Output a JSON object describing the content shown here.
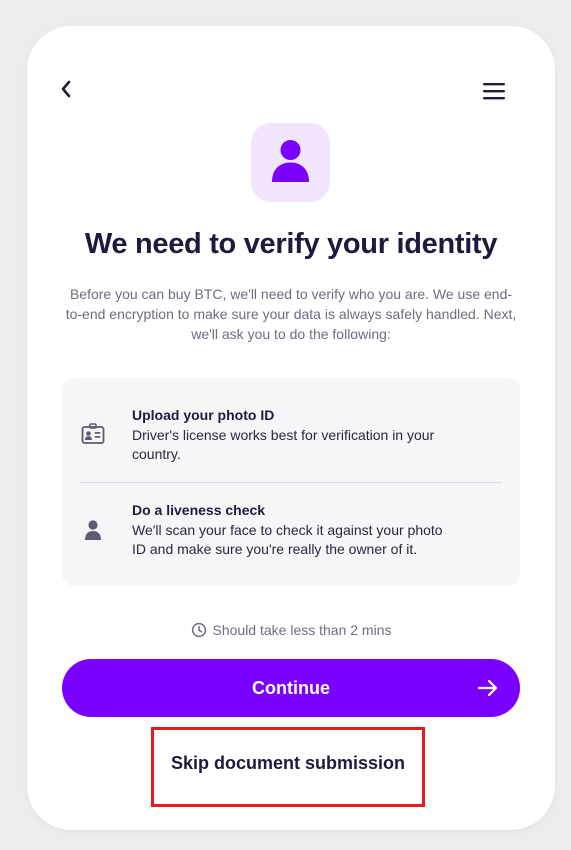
{
  "header": {
    "back_icon": "chevron-left-icon",
    "menu_icon": "hamburger-menu-icon"
  },
  "hero": {
    "icon": "user-icon",
    "icon_bg_color": "#f2e6ff",
    "icon_color": "#7a00ff"
  },
  "main": {
    "title": "We need to verify your identity",
    "intro": "Before you can buy BTC, we'll need to verify who you are. We use end-to-end encryption to make sure your data is always safely handled. Next, we'll ask you to do the following:"
  },
  "steps": [
    {
      "icon": "id-card-icon",
      "title": "Upload your photo ID",
      "description": "Driver's license works best for verification in your country."
    },
    {
      "icon": "person-icon",
      "title": "Do a liveness check",
      "description": "We'll scan your face to check it against your photo ID and make sure you're really the owner of it."
    }
  ],
  "time_note": {
    "icon": "clock-icon",
    "text": "Should take less than 2 mins"
  },
  "actions": {
    "continue_label": "Continue",
    "continue_icon": "arrow-right-icon",
    "skip_label": "Skip document submission"
  },
  "colors": {
    "accent": "#7a00ff",
    "highlight_border": "#e81c1c",
    "title_text": "#1e1a3d"
  }
}
